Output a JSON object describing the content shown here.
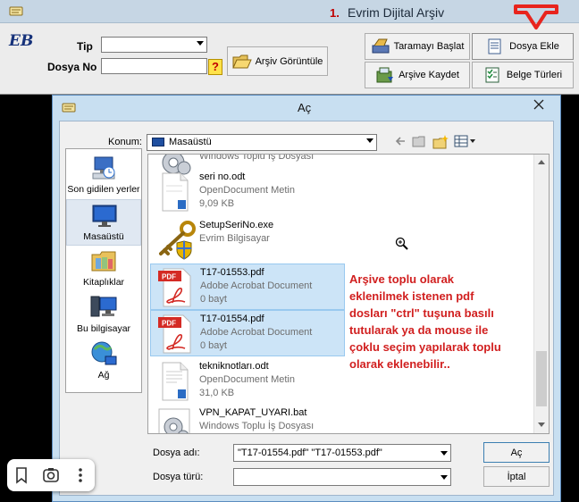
{
  "app": {
    "step_number": "1.",
    "title": "Evrim Dijital Arşiv",
    "logo_text": "EB",
    "fields": {
      "tip_label": "Tip",
      "tip_value": "",
      "dosya_no_label": "Dosya No",
      "dosya_no_value": "",
      "help_label": "?"
    },
    "buttons": {
      "arsiv_goruntule": "Arşiv Görüntüle",
      "taramayi_baslat": "Taramayı Başlat",
      "dosya_ekle": "Dosya Ekle",
      "arsive_kaydet": "Arşive Kaydet",
      "belge_turleri": "Belge Türleri"
    },
    "arrow_color": "#e8241d"
  },
  "dialog": {
    "title": "Aç",
    "location_label": "Konum:",
    "location_value": "Masaüstü",
    "places": [
      {
        "label": "Son gidilen yerler",
        "icon": "recent-places-icon"
      },
      {
        "label": "Masaüstü",
        "icon": "desktop-icon"
      },
      {
        "label": "Kitaplıklar",
        "icon": "libraries-icon"
      },
      {
        "label": "Bu bilgisayar",
        "icon": "computer-icon"
      },
      {
        "label": "Ağ",
        "icon": "network-icon"
      }
    ],
    "files": [
      {
        "name": "",
        "type": "Windows Toplu İş Dosyası",
        "size": "",
        "icon": "batch-file-icon",
        "selected": false
      },
      {
        "name": "seri no.odt",
        "type": "OpenDocument Metin",
        "size": "9,09 KB",
        "icon": "document-icon",
        "selected": false
      },
      {
        "name": "SetupSeriNo.exe",
        "type": "Evrim Bilgisayar",
        "size": "",
        "icon": "key-exe-icon",
        "selected": false
      },
      {
        "name": "T17-01553.pdf",
        "type": "Adobe Acrobat Document",
        "size": "0 bayt",
        "icon": "pdf-icon",
        "selected": true
      },
      {
        "name": "T17-01554.pdf",
        "type": "Adobe Acrobat Document",
        "size": "0 bayt",
        "icon": "pdf-icon",
        "selected": true
      },
      {
        "name": "tekniknotları.odt",
        "type": "OpenDocument Metin",
        "size": "31,0 KB",
        "icon": "document-icon",
        "selected": false
      },
      {
        "name": "VPN_KAPAT_UYARI.bat",
        "type": "Windows Toplu İş Dosyası",
        "size": "",
        "icon": "batch-file-icon",
        "selected": false
      }
    ],
    "annotation": "Arşive toplu olarak eklenilmek istenen pdf dosları \"ctrl\" tuşuna basılı tutularak ya da mouse ile çoklu seçim yapılarak toplu olarak eklenebilir..",
    "filename_label": "Dosya adı:",
    "filename_value": "\"T17-01554.pdf\" \"T17-01553.pdf\"",
    "filetype_label": "Dosya türü:",
    "filetype_value": "",
    "open_button": "Aç",
    "cancel_button": "İptal"
  },
  "overlay_toolbar": {
    "icons": [
      "bookmark-icon",
      "lens-icon",
      "more-icon"
    ]
  },
  "colors": {
    "annotation": "#d11f1f",
    "selection": "#cce4f7",
    "dialog_frame": "#c8dff1"
  }
}
